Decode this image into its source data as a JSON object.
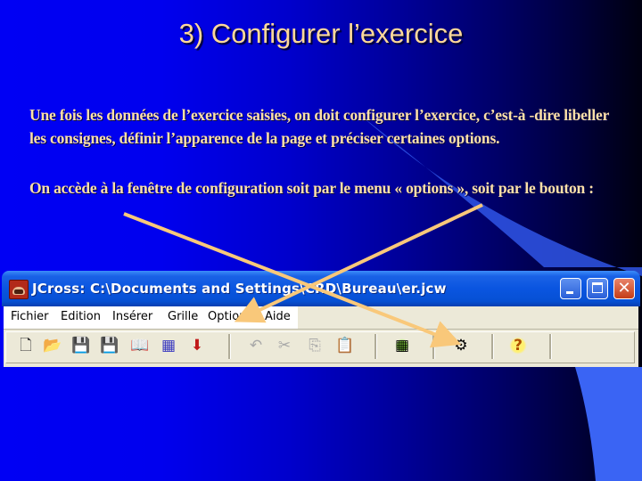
{
  "slide": {
    "title": "3) Configurer l’exercice",
    "paragraph1": "Une fois les données de l’exercice saisies, on doit configurer l’exercice, c’est-à -dire libeller les consignes, définir l’apparence de la page et préciser certaines options.",
    "paragraph2": "On accède à la fenêtre de configuration soit par le menu « options », soit par le bouton :",
    "text_color": "#fde0a8",
    "arrow_color": "#f9c87a"
  },
  "window": {
    "title": "JCross: C:\\Documents and Settings\\CRD\\Bureau\\er.jcw",
    "app_icon": "jcross-app-icon",
    "controls": {
      "minimize": "minimize",
      "maximize": "maximize",
      "close": "✕"
    }
  },
  "menu": {
    "items": [
      "Fichier",
      "Edition",
      "Insérer",
      "Grille",
      "Options",
      "Aide"
    ]
  },
  "toolbar": {
    "buttons": [
      {
        "name": "new-file",
        "glyph": "🗋",
        "enabled": true
      },
      {
        "name": "open-folder",
        "glyph": "📂",
        "enabled": true
      },
      {
        "name": "save",
        "glyph": "💾",
        "enabled": true
      },
      {
        "name": "save-as",
        "glyph": "💾",
        "enabled": true
      },
      {
        "name": "open-book",
        "glyph": "📖",
        "enabled": true
      },
      {
        "name": "make-grid",
        "glyph": "▦",
        "enabled": true
      },
      {
        "name": "export-arrow",
        "glyph": "🡫",
        "enabled": true
      },
      {
        "name": "undo",
        "glyph": "↶",
        "enabled": false
      },
      {
        "name": "cut",
        "glyph": "✂",
        "enabled": false
      },
      {
        "name": "copy",
        "glyph": "⎘",
        "enabled": false
      },
      {
        "name": "paste",
        "glyph": "📋",
        "enabled": false
      },
      {
        "name": "grid-config",
        "glyph": "▦",
        "enabled": true
      },
      {
        "name": "configure-output",
        "glyph": "⚙",
        "enabled": true
      },
      {
        "name": "help",
        "glyph": "?",
        "enabled": true
      }
    ]
  }
}
